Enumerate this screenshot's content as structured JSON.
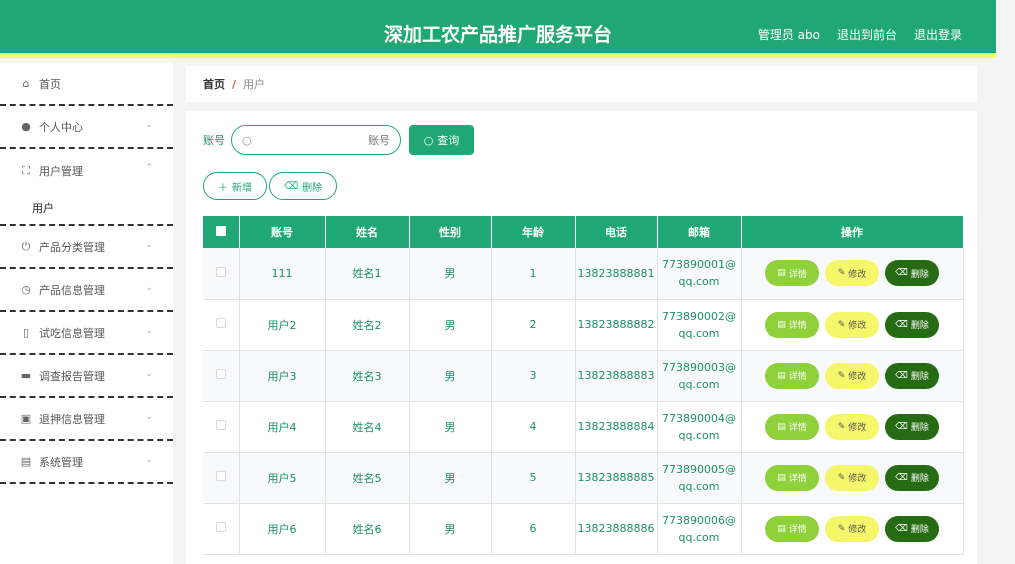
{
  "header": {
    "title": "深加工农产品推广服务平台",
    "user": "管理员 abo",
    "front_link": "退出到前台",
    "logout": "退出登录"
  },
  "sidebar": {
    "items": [
      {
        "label": "首页",
        "icon": "home-icon",
        "glyph": "⌂",
        "chevron": ""
      },
      {
        "label": "个人中心",
        "icon": "user-icon",
        "glyph": "●",
        "chevron": "⌄"
      },
      {
        "label": "用户管理",
        "icon": "frame-icon",
        "glyph": "⛶",
        "chevron": "⌃"
      },
      {
        "label": "产品分类管理",
        "icon": "power-icon",
        "glyph": "⏻",
        "chevron": "⌄"
      },
      {
        "label": "产品信息管理",
        "icon": "clock-icon",
        "glyph": "◷",
        "chevron": "⌄"
      },
      {
        "label": "试吃信息管理",
        "icon": "bulb-icon",
        "glyph": "▯",
        "chevron": "⌄"
      },
      {
        "label": "调查报告管理",
        "icon": "monitor-icon",
        "glyph": "▬",
        "chevron": "⌄"
      },
      {
        "label": "退押信息管理",
        "icon": "clipboard-icon",
        "glyph": "▣",
        "chevron": "⌄"
      },
      {
        "label": "系统管理",
        "icon": "briefcase-icon",
        "glyph": "▤",
        "chevron": "⌄"
      }
    ],
    "sub_item": "用户"
  },
  "breadcrumb": {
    "home": "首页",
    "sep": "/",
    "current": "用户"
  },
  "search": {
    "label": "账号",
    "placeholder": "账号",
    "button": "查询"
  },
  "actions": {
    "add": "新增",
    "delete": "删除"
  },
  "table": {
    "headers": [
      "账号",
      "姓名",
      "性别",
      "年龄",
      "电话",
      "邮箱",
      "操作"
    ],
    "rows": [
      {
        "account": "111",
        "name": "姓名1",
        "gender": "男",
        "age": "1",
        "phone": "13823888881",
        "email1": "773890001@",
        "email2": "qq.com"
      },
      {
        "account": "用户2",
        "name": "姓名2",
        "gender": "男",
        "age": "2",
        "phone": "13823888882",
        "email1": "773890002@",
        "email2": "qq.com"
      },
      {
        "account": "用户3",
        "name": "姓名3",
        "gender": "男",
        "age": "3",
        "phone": "13823888883",
        "email1": "773890003@",
        "email2": "qq.com"
      },
      {
        "account": "用户4",
        "name": "姓名4",
        "gender": "男",
        "age": "4",
        "phone": "13823888884",
        "email1": "773890004@",
        "email2": "qq.com"
      },
      {
        "account": "用户5",
        "name": "姓名5",
        "gender": "男",
        "age": "5",
        "phone": "13823888885",
        "email1": "773890005@",
        "email2": "qq.com"
      },
      {
        "account": "用户6",
        "name": "姓名6",
        "gender": "男",
        "age": "6",
        "phone": "13823888886",
        "email1": "773890006@",
        "email2": "qq.com"
      }
    ],
    "ops": {
      "detail": "详情",
      "edit": "修改",
      "delete": "删除"
    }
  },
  "colors": {
    "primary": "#1fa876",
    "accent_yellow": "#f4f86a",
    "detail": "#8fd13a",
    "edit": "#f6f66b",
    "danger": "#266b14"
  }
}
